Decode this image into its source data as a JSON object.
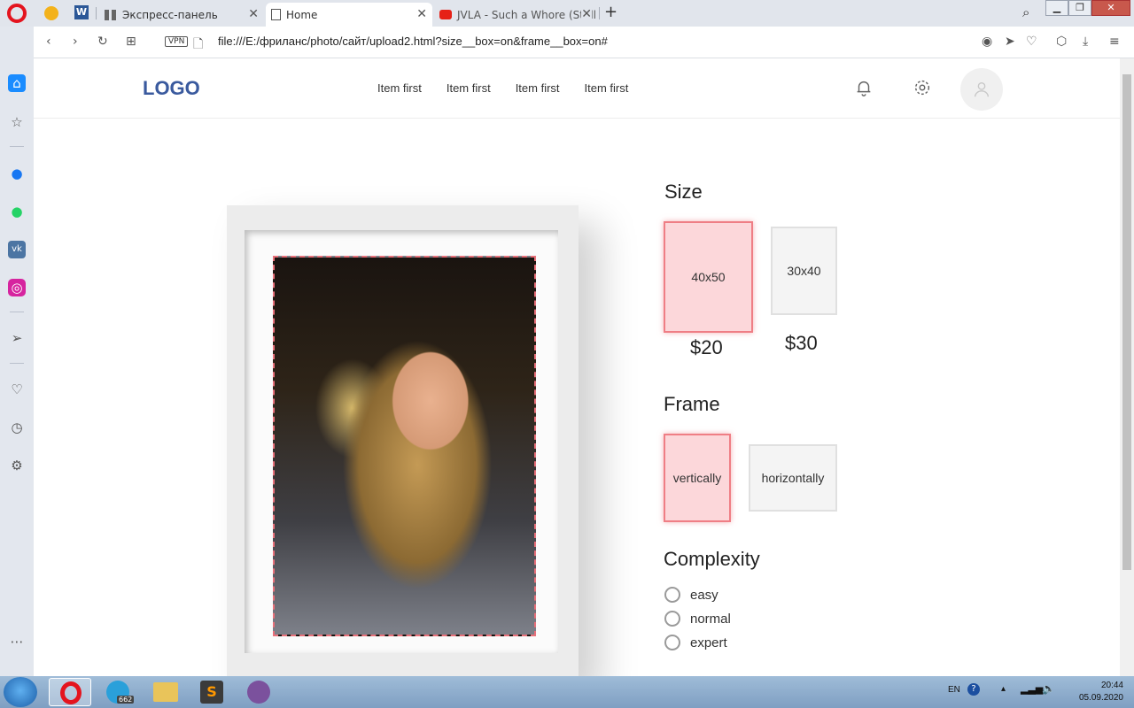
{
  "browser": {
    "tabs": [
      {
        "label": "Экспресс-панель"
      },
      {
        "label": "Home"
      },
      {
        "label": "JVLA - Such a Whore (Stell"
      }
    ],
    "new_tab": "+",
    "vpn": "VPN",
    "url": "file:///E:/фриланс/photo/сайт/upload2.html?size__box=on&frame__box=on#"
  },
  "header": {
    "logo": "LOGO",
    "nav": [
      "Item first",
      "Item first",
      "Item first",
      "Item first"
    ]
  },
  "options": {
    "size": {
      "title": "Size",
      "items": [
        {
          "label": "40x50",
          "price": "$20",
          "selected": true
        },
        {
          "label": "30x40",
          "price": "$30",
          "selected": false
        }
      ]
    },
    "frame": {
      "title": "Frame",
      "items": [
        {
          "label": "vertically",
          "selected": true
        },
        {
          "label": "horizontally",
          "selected": false
        }
      ]
    },
    "complexity": {
      "title": "Complexity",
      "items": [
        "easy",
        "normal",
        "expert"
      ]
    }
  },
  "taskbar": {
    "lang": "EN",
    "time": "20:44",
    "date": "05.09.2020",
    "telegram_badge": "662"
  },
  "colors": {
    "accent_selected": "#fcd7da",
    "accent_border": "#ef7e85",
    "logo": "#3a5a9e"
  }
}
